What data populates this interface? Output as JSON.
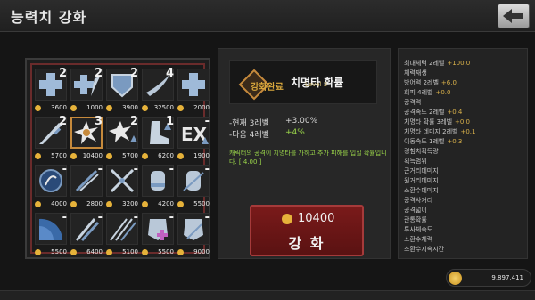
{
  "header": {
    "title": "능력치 강화"
  },
  "grid": [
    {
      "level": "2",
      "price": "3600",
      "icon": "plus-cross-icon"
    },
    {
      "level": "2",
      "price": "1000",
      "icon": "plus-arrow-icon"
    },
    {
      "level": "2",
      "price": "3900",
      "icon": "shield-icon"
    },
    {
      "level": "4",
      "price": "32500",
      "icon": "cape-icon"
    },
    {
      "level": "",
      "price": "2000",
      "icon": "plus-cross-icon"
    },
    {
      "level": "2",
      "price": "5700",
      "icon": "dagger-icon"
    },
    {
      "level": "3",
      "price": "10400",
      "icon": "critical-burst-icon"
    },
    {
      "level": "2",
      "price": "5700",
      "icon": "burst-up-icon"
    },
    {
      "level": "1",
      "price": "6200",
      "icon": "boot-icon"
    },
    {
      "level": "-",
      "price": "1900",
      "icon": "exp-icon"
    },
    {
      "level": "-",
      "price": "4000",
      "icon": "rune-circle-icon"
    },
    {
      "level": "-",
      "price": "2800",
      "icon": "crossed-arrows-icon"
    },
    {
      "level": "-",
      "price": "3200",
      "icon": "crossed-bows-icon"
    },
    {
      "level": "-",
      "price": "4200",
      "icon": "gauntlet-icon"
    },
    {
      "level": "-",
      "price": "5500",
      "icon": "gauntlet-crossed-icon"
    },
    {
      "level": "-",
      "price": "5500",
      "icon": "radar-icon"
    },
    {
      "level": "-",
      "price": "6400",
      "icon": "double-sword-icon"
    },
    {
      "level": "-",
      "price": "5100",
      "icon": "triple-sword-icon"
    },
    {
      "level": "-",
      "price": "5500",
      "icon": "armor-plus-icon"
    },
    {
      "level": "-",
      "price": "9000",
      "icon": "armor-crossed-icon"
    }
  ],
  "detail": {
    "skill_name": "치명타 확률",
    "badge": "강화완료",
    "level": "Level 3",
    "current_label": "-현재 3레벨",
    "current_value": "+3.00%",
    "next_label": "-다음 4레벨",
    "next_value": "+4%",
    "description": "캐릭터의 공격이 치명타를 가하고 추가 피해를 입힐 확률입니다. [ 4.00 ]"
  },
  "upgrade": {
    "price": "10400",
    "label": "강 화"
  },
  "stats": [
    {
      "label": "최대체력",
      "level": "2레벨",
      "value": "+100.0"
    },
    {
      "label": "체력재생",
      "level": "",
      "value": ""
    },
    {
      "label": "방어력",
      "level": "2레벨",
      "value": "+6.0"
    },
    {
      "label": "회피",
      "level": "4레벨",
      "value": "+0.0"
    },
    {
      "label": "공격력",
      "level": "",
      "value": ""
    },
    {
      "label": "공격속도",
      "level": "2레벨",
      "value": "+0.4"
    },
    {
      "label": "치명타 확률",
      "level": "3레벨",
      "value": "+0.0"
    },
    {
      "label": "치명타 데미지",
      "level": "2레벨",
      "value": "+0.1"
    },
    {
      "label": "이동속도",
      "level": "1레벨",
      "value": "+0.3"
    },
    {
      "label": "경험치획득량",
      "level": "",
      "value": ""
    },
    {
      "label": "획득범위",
      "level": "",
      "value": ""
    },
    {
      "label": "근거리데미지",
      "level": "",
      "value": ""
    },
    {
      "label": "원거리데미지",
      "level": "",
      "value": ""
    },
    {
      "label": "소환수데미지",
      "level": "",
      "value": ""
    },
    {
      "label": "공격사거리",
      "level": "",
      "value": ""
    },
    {
      "label": "공격넓이",
      "level": "",
      "value": ""
    },
    {
      "label": "관통확률",
      "level": "",
      "value": ""
    },
    {
      "label": "투사체속도",
      "level": "",
      "value": ""
    },
    {
      "label": "소환수체력",
      "level": "",
      "value": ""
    },
    {
      "label": "소환수지속시간",
      "level": "",
      "value": ""
    }
  ],
  "gold": {
    "amount": "9,897,411"
  },
  "colors": {
    "accent_gold": "#e6b23a",
    "button_red": "#7a1a1a",
    "positive_green": "#9bd64a"
  }
}
